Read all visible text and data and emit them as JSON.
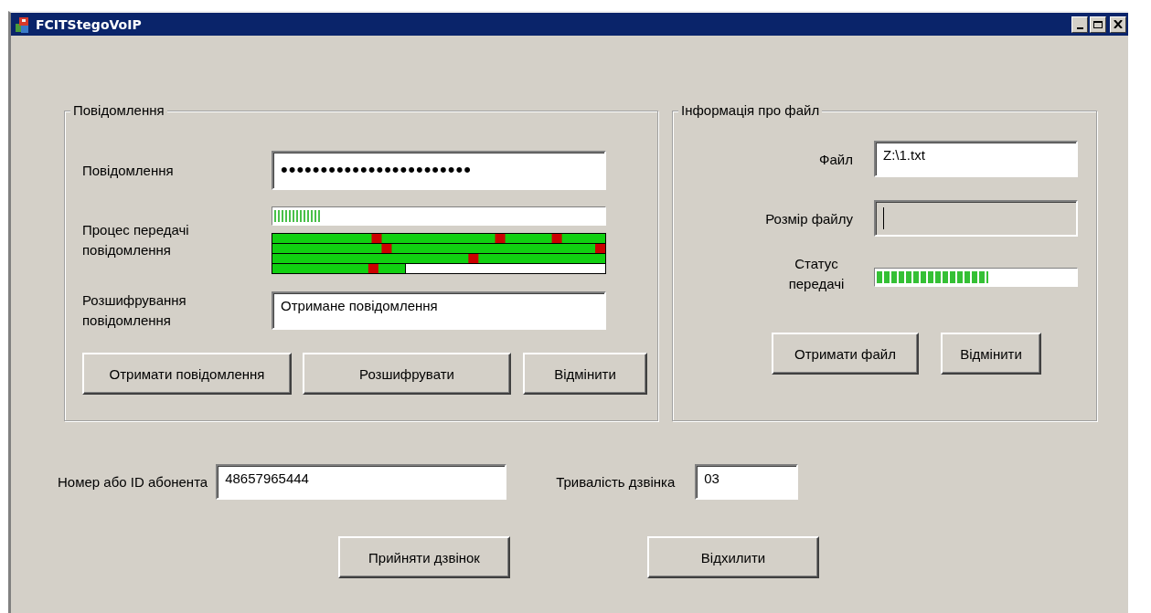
{
  "window": {
    "title": "FCITStegoVoIP"
  },
  "message_group": {
    "title": "Повідомлення",
    "message_label": "Повідомлення",
    "message_value": "••••••••••••••••••••••••",
    "progress_label": "Процес передачі повідомлення",
    "progress": {
      "level": 0.14
    },
    "decrypt_label": "Розшифрування повідомлення",
    "decrypt_value": "Отримане повідомлення",
    "buttons": [
      "Отримати повідомлення",
      "Розшифрувати",
      "Відмінити"
    ]
  },
  "file_group": {
    "title": "Інформація про файл",
    "fields": [
      {
        "label": "Файл",
        "value": "Z:\\1.txt",
        "disabled": false
      },
      {
        "label": "Розмір файлу",
        "disabled": true
      }
    ],
    "status_label": "Статус передачі",
    "status": {
      "level": 0.56
    },
    "buttons": [
      "Отримати файл",
      "Відмінити"
    ]
  },
  "caller": {
    "label": "Номер або ID абонента",
    "value": "48657965444"
  },
  "duration": {
    "label": "Тривалість дзвінка",
    "value": "03"
  },
  "call_buttons": [
    "Прийняти дзвінок",
    "Відхилити"
  ]
}
